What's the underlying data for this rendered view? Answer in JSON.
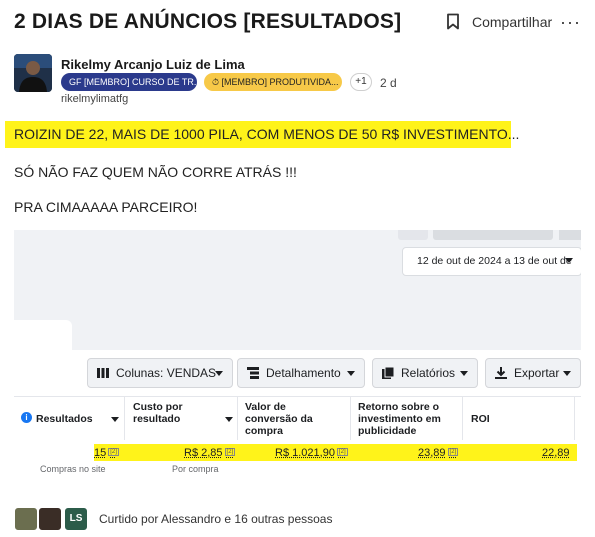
{
  "post": {
    "title": "2 DIAS DE ANÚNCIOS [RESULTADOS]",
    "share_label": "Compartilhar",
    "more_label": "···",
    "author": "Rikelmy Arcanjo Luiz de Lima",
    "badges": [
      "[MEMBRO] CURSO DE TR...",
      "[MEMBRO] PRODUTIVIDA..."
    ],
    "badge_prefixes": [
      "GF",
      "⏱"
    ],
    "badge_more": "+1",
    "time_ago": "2 d",
    "handle": "rikelmylimatfg",
    "lines": [
      "ROIZIN DE 22, MAIS DE 1000 PILA, COM MENOS DE 50 R$ INVESTIMENTO...",
      "SÓ NÃO FAZ QUEM NÃO CORRE ATRÁS !!!",
      "PRA CIMAAAAA PARCEIRO!"
    ]
  },
  "screenshot": {
    "date_range": "12 de out de 2024 a 13 de out de",
    "toolbar": {
      "columns": "Colunas: VENDAS",
      "breakdown": "Detalhamento",
      "reports": "Relatórios",
      "export": "Exportar"
    },
    "headers": {
      "results": "Resultados",
      "cost": "Custo por resultado",
      "conversion": "Valor de conversão da compra",
      "return": "Retorno sobre o investimento em publicidade",
      "roi": "ROI"
    },
    "row": {
      "results": "15",
      "cost": "R$ 2,85",
      "conversion": "R$ 1.021,90",
      "return": "23,89",
      "roi": "22,89",
      "footnote": "[2]"
    },
    "subs": {
      "results": "Compras no site",
      "cost": "Por compra"
    }
  },
  "likes": {
    "initials": "LS",
    "text": "Curtido por Alessandro e 16 outras pessoas"
  }
}
